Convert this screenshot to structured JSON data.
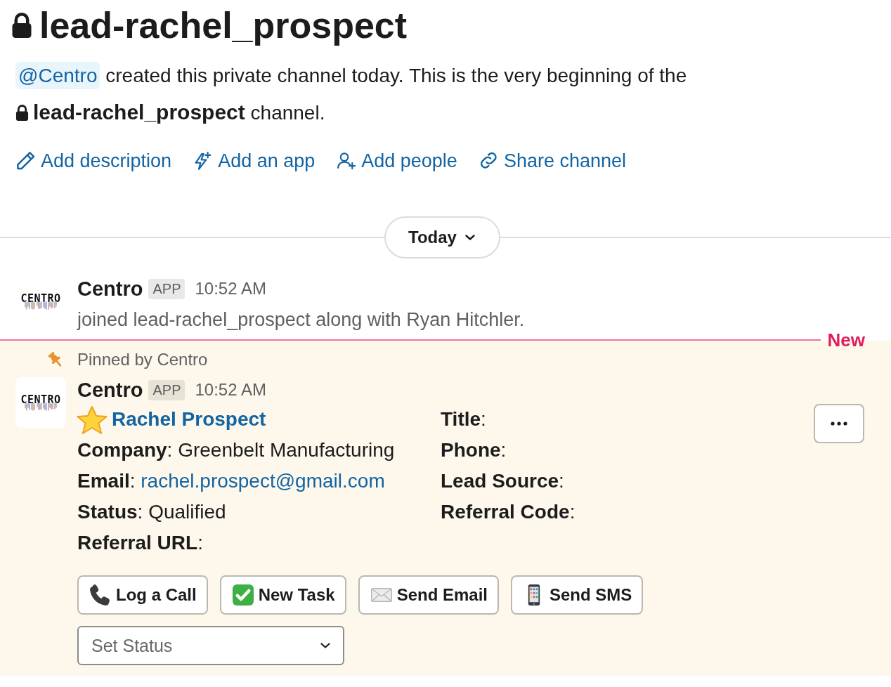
{
  "channel": {
    "title": "lead-rachel_prospect"
  },
  "intro": {
    "mention": "@Centro",
    "text": "created this private channel today. This is the very beginning of the",
    "channel": "lead-rachel_prospect",
    "suffix": "channel."
  },
  "actions": [
    {
      "label": "Add description"
    },
    {
      "label": "Add an app"
    },
    {
      "label": "Add people"
    },
    {
      "label": "Share channel"
    }
  ],
  "day_divider": {
    "label": "Today"
  },
  "messages": [
    {
      "avatar_text": "CENTRO",
      "sender": "Centro",
      "badge": "APP",
      "time": "10:52 AM",
      "text": "joined lead-rachel_prospect along with Ryan Hitchler."
    },
    {
      "new_marker": "New",
      "pinned_label": "Pinned by Centro",
      "avatar_text": "CENTRO",
      "sender": "Centro",
      "badge": "APP",
      "time": "10:52 AM",
      "card": {
        "title": "Rachel Prospect",
        "left_fields": [
          {
            "text": "**Company**: Greenbelt Manufacturing"
          },
          {
            "text": "**Email**: ",
            "link": "rachel.prospect@gmail.com"
          },
          {
            "text": "**Status**: Qualified"
          },
          {
            "text": "**Referral URL**:"
          }
        ],
        "right_fields": [
          {
            "text": "**Title**:"
          },
          {
            "text": "**Phone**:"
          },
          {
            "text": "**Lead Source**:"
          },
          {
            "text": "**Referral Code**:"
          }
        ],
        "buttons": [
          {
            "label": "Log a Call"
          },
          {
            "label": "New Task"
          },
          {
            "label": "Send Email"
          },
          {
            "label": "Send SMS"
          }
        ],
        "select": {
          "placeholder": "Set Status"
        }
      }
    }
  ]
}
